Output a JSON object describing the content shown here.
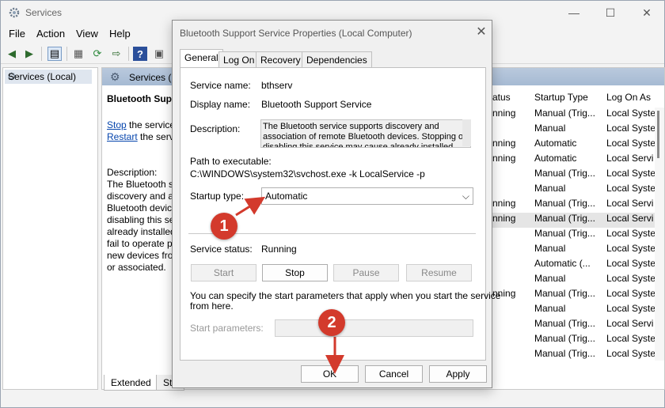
{
  "window": {
    "title": "Services",
    "controls": {
      "minimize": "—",
      "maximize": "☐",
      "close": "✕"
    }
  },
  "menu": [
    "File",
    "Action",
    "View",
    "Help"
  ],
  "tree": {
    "item": "Services (Local)"
  },
  "right_pane": {
    "header": "Services (Lo",
    "desc_title": "Bluetooth Supp",
    "stop_link": "Stop",
    "stop_text": " the service",
    "restart_link": "Restart",
    "restart_text": " the servi",
    "desc_label": "Description:",
    "desc_lines": [
      "The Bluetooth se",
      "discovery and as",
      "Bluetooth device",
      "disabling this se",
      "already installed",
      "fail to operate pr",
      "new devices fror",
      "or associated."
    ],
    "columns": {
      "status": "atus",
      "startup_type": "Startup Type",
      "log_on_as": "Log On As"
    },
    "rows": [
      {
        "status": "nning",
        "startup": "Manual (Trig...",
        "logon": "Local Syste"
      },
      {
        "status": "",
        "startup": "Manual",
        "logon": "Local Syste"
      },
      {
        "status": "nning",
        "startup": "Automatic",
        "logon": "Local Syste"
      },
      {
        "status": "nning",
        "startup": "Automatic",
        "logon": "Local Servi"
      },
      {
        "status": "",
        "startup": "Manual (Trig...",
        "logon": "Local Syste"
      },
      {
        "status": "",
        "startup": "Manual",
        "logon": "Local Syste"
      },
      {
        "status": "nning",
        "startup": "Manual (Trig...",
        "logon": "Local Servi"
      },
      {
        "status": "nning",
        "startup": "Manual (Trig...",
        "logon": "Local Servi"
      },
      {
        "status": "",
        "startup": "Manual (Trig...",
        "logon": "Local Syste"
      },
      {
        "status": "",
        "startup": "Manual",
        "logon": "Local Syste"
      },
      {
        "status": "",
        "startup": "Automatic (...",
        "logon": "Local Syste"
      },
      {
        "status": "",
        "startup": "Manual",
        "logon": "Local Syste"
      },
      {
        "status": "nning",
        "startup": "Manual (Trig...",
        "logon": "Local Syste"
      },
      {
        "status": "",
        "startup": "Manual",
        "logon": "Local Syste"
      },
      {
        "status": "",
        "startup": "Manual (Trig...",
        "logon": "Local Servi"
      },
      {
        "status": "",
        "startup": "Manual (Trig...",
        "logon": "Local Syste"
      },
      {
        "status": "",
        "startup": "Manual (Trig...",
        "logon": "Local Syste"
      }
    ],
    "tabs": [
      "Extended",
      "Sta"
    ]
  },
  "dialog": {
    "title": "Bluetooth Support Service Properties (Local Computer)",
    "close": "✕",
    "tabs": [
      "General",
      "Log On",
      "Recovery",
      "Dependencies"
    ],
    "service_name_label": "Service name:",
    "service_name": "bthserv",
    "display_name_label": "Display name:",
    "display_name": "Bluetooth Support Service",
    "description_label": "Description:",
    "description": "The Bluetooth service supports discovery and association of remote Bluetooth devices.  Stopping or disabling this service may cause already installed",
    "path_label": "Path to executable:",
    "path": "C:\\WINDOWS\\system32\\svchost.exe -k LocalService -p",
    "startup_label": "Startup type:",
    "startup_value": "Automatic",
    "status_label": "Service status:",
    "status_value": "Running",
    "buttons": {
      "start": "Start",
      "stop": "Stop",
      "pause": "Pause",
      "resume": "Resume"
    },
    "params_help_1": "You can specify the start parameters that apply when you start the service",
    "params_help_2": "from here.",
    "params_label": "Start parameters:",
    "ok": "OK",
    "cancel": "Cancel",
    "apply": "Apply"
  },
  "annotations": {
    "step1": "1",
    "step2": "2",
    "color": "#d33a2c"
  }
}
